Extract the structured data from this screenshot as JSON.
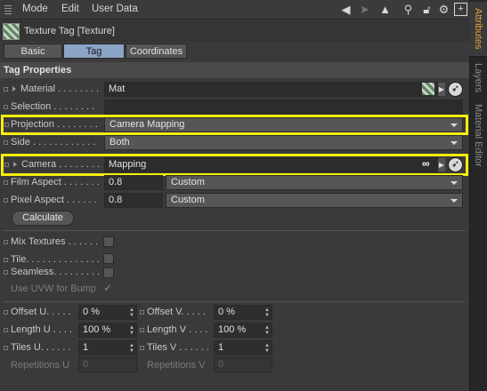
{
  "menubar": {
    "items": [
      "Mode",
      "Edit",
      "User Data"
    ],
    "icons": [
      "arrow-left-icon",
      "arrow-right-icon",
      "cursor-icon",
      "search-icon",
      "lock-icon",
      "settings-icon",
      "new-panel-icon"
    ]
  },
  "side_tabs": {
    "attributes": "Attributes",
    "layers": "Layers",
    "material_editor": "Material Editor"
  },
  "header": {
    "title": "Texture Tag [Texture]"
  },
  "tabs": [
    {
      "label": "Basic",
      "active": false
    },
    {
      "label": "Tag",
      "active": true
    },
    {
      "label": "Coordinates",
      "active": false
    }
  ],
  "section": {
    "title": "Tag Properties"
  },
  "props": {
    "material": {
      "label": "Material . . . . . . . .",
      "value": "Mat"
    },
    "selection": {
      "label": "Selection . . . . . . . .",
      "value": ""
    },
    "projection": {
      "label": "Projection . . . . . . . .",
      "value": "Camera Mapping"
    },
    "side": {
      "label": "Side . . . . . . . . . . . .",
      "value": "Both"
    },
    "camera": {
      "label": "Camera . . . . . . . .",
      "value": "Mapping",
      "link_symbol": "∞"
    },
    "film_aspect": {
      "label": "Film Aspect . . . . . . .",
      "value": "0.8",
      "preset": "Custom"
    },
    "pixel_aspect": {
      "label": "Pixel Aspect . . . . . .",
      "value": "0.8",
      "preset": "Custom"
    },
    "calculate": "Calculate"
  },
  "options": {
    "mix_textures": "Mix Textures . . . . . .",
    "tile": "Tile. . . . . . . . . . . . . .",
    "seamless": "Seamless. . . . . . . . . .",
    "use_uvw": "Use UVW for Bump",
    "use_uvw_check": "✓"
  },
  "offset": {
    "offset_u": {
      "label": "Offset U. . . . .",
      "value": "0 %"
    },
    "offset_v": {
      "label": "Offset V. . . . .",
      "value": "0 %"
    },
    "length_u": {
      "label": "Length U . . . .",
      "value": "100 %"
    },
    "length_v": {
      "label": "Length V . . . .",
      "value": "100 %"
    },
    "tiles_u": {
      "label": "Tiles U. . . . . .",
      "value": "1"
    },
    "tiles_v": {
      "label": "Tiles V . . . . . .",
      "value": "1"
    },
    "repetitions_u": {
      "label": "Repetitions U",
      "value": "0"
    },
    "repetitions_v": {
      "label": "Repetitions V",
      "value": "0"
    }
  },
  "colors": {
    "highlight": "#f6ef0b",
    "active_tab": "#8aa3c6",
    "side_tab_active": "#e8a23a"
  }
}
